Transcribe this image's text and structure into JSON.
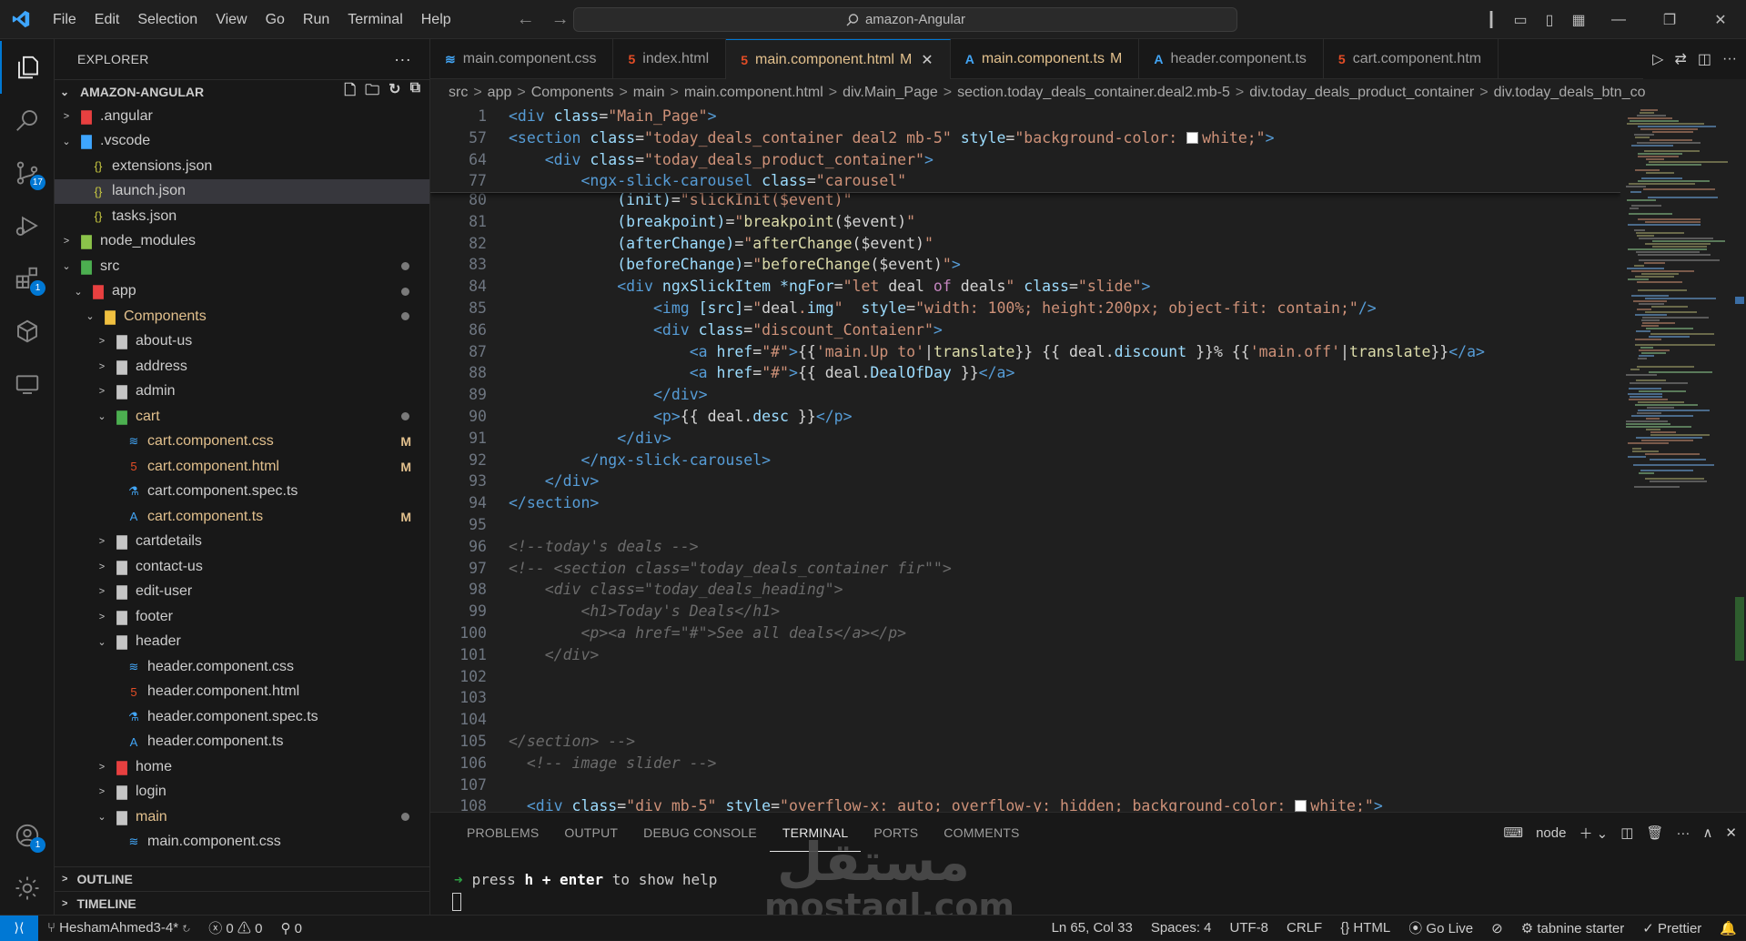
{
  "titlebar": {
    "menus": [
      "File",
      "Edit",
      "Selection",
      "View",
      "Go",
      "Run",
      "Terminal",
      "Help"
    ],
    "search_text": "amazon-Angular"
  },
  "activity": {
    "scm_badge": "17",
    "extensions_badge": "1",
    "accounts_badge": "1"
  },
  "explorer": {
    "title": "EXPLORER",
    "more": "···",
    "project": "AMAZON-ANGULAR",
    "tree": [
      {
        "label": ".angular",
        "depth": 1,
        "chev": ">",
        "icon": "angular-folder-icon",
        "color": "#e84040"
      },
      {
        "label": ".vscode",
        "depth": 1,
        "chev": "v",
        "icon": "vscode-folder-icon",
        "color": "#3ea6ff"
      },
      {
        "label": "extensions.json",
        "depth": 2,
        "icon": "json-icon",
        "color": "#cbcb41"
      },
      {
        "label": "launch.json",
        "depth": 2,
        "icon": "json-icon",
        "color": "#cbcb41",
        "selected": true
      },
      {
        "label": "tasks.json",
        "depth": 2,
        "icon": "json-icon",
        "color": "#cbcb41"
      },
      {
        "label": "node_modules",
        "depth": 1,
        "chev": ">",
        "icon": "node-folder-icon",
        "color": "#8bc34a"
      },
      {
        "label": "src",
        "depth": 1,
        "chev": "v",
        "icon": "src-folder-icon",
        "color": "#4caf50",
        "dot": true
      },
      {
        "label": "app",
        "depth": 2,
        "chev": "v",
        "icon": "app-folder-icon",
        "color": "#e84040",
        "dot": true
      },
      {
        "label": "Components",
        "depth": 3,
        "chev": "v",
        "icon": "components-folder-icon",
        "color": "#f0c040",
        "mod": true,
        "dot": true
      },
      {
        "label": "about-us",
        "depth": 4,
        "chev": ">",
        "icon": "folder-icon",
        "color": "#c5c5c5"
      },
      {
        "label": "address",
        "depth": 4,
        "chev": ">",
        "icon": "folder-icon",
        "color": "#c5c5c5"
      },
      {
        "label": "admin",
        "depth": 4,
        "chev": ">",
        "icon": "admin-folder-icon",
        "color": "#c5c5c5"
      },
      {
        "label": "cart",
        "depth": 4,
        "chev": "v",
        "icon": "cart-folder-icon",
        "color": "#4caf50",
        "mod": true,
        "dot": true
      },
      {
        "label": "cart.component.css",
        "depth": 5,
        "icon": "css-icon",
        "color": "#42a5f5",
        "mod": true,
        "stat": "M"
      },
      {
        "label": "cart.component.html",
        "depth": 5,
        "icon": "html-icon",
        "color": "#e44d26",
        "mod": true,
        "stat": "M"
      },
      {
        "label": "cart.component.spec.ts",
        "depth": 5,
        "icon": "flask-icon",
        "color": "#42a5f5"
      },
      {
        "label": "cart.component.ts",
        "depth": 5,
        "icon": "angular-icon",
        "color": "#42a5f5",
        "mod": true,
        "stat": "M"
      },
      {
        "label": "cartdetails",
        "depth": 4,
        "chev": ">",
        "icon": "folder-icon",
        "color": "#c5c5c5"
      },
      {
        "label": "contact-us",
        "depth": 4,
        "chev": ">",
        "icon": "folder-icon",
        "color": "#c5c5c5"
      },
      {
        "label": "edit-user",
        "depth": 4,
        "chev": ">",
        "icon": "folder-icon",
        "color": "#c5c5c5"
      },
      {
        "label": "footer",
        "depth": 4,
        "chev": ">",
        "icon": "folder-icon",
        "color": "#c5c5c5"
      },
      {
        "label": "header",
        "depth": 4,
        "chev": "v",
        "icon": "folder-icon",
        "color": "#c5c5c5"
      },
      {
        "label": "header.component.css",
        "depth": 5,
        "icon": "css-icon",
        "color": "#42a5f5"
      },
      {
        "label": "header.component.html",
        "depth": 5,
        "icon": "html-icon",
        "color": "#e44d26"
      },
      {
        "label": "header.component.spec.ts",
        "depth": 5,
        "icon": "flask-icon",
        "color": "#42a5f5"
      },
      {
        "label": "header.component.ts",
        "depth": 5,
        "icon": "angular-icon",
        "color": "#42a5f5"
      },
      {
        "label": "home",
        "depth": 4,
        "chev": ">",
        "icon": "home-folder-icon",
        "color": "#e84040"
      },
      {
        "label": "login",
        "depth": 4,
        "chev": ">",
        "icon": "folder-icon",
        "color": "#c5c5c5"
      },
      {
        "label": "main",
        "depth": 4,
        "chev": "v",
        "icon": "folder-icon",
        "color": "#c5c5c5",
        "mod": true,
        "dot": true
      },
      {
        "label": "main.component.css",
        "depth": 5,
        "icon": "css-icon",
        "color": "#42a5f5"
      }
    ],
    "outline": "OUTLINE",
    "timeline": "TIMELINE"
  },
  "tabs": [
    {
      "label": "main.component.css",
      "icon": "css-icon",
      "color": "#42a5f5"
    },
    {
      "label": "index.html",
      "icon": "html-icon",
      "color": "#e44d26"
    },
    {
      "label": "main.component.html",
      "icon": "html-icon",
      "color": "#e44d26",
      "active": true,
      "modified": "M"
    },
    {
      "label": "main.component.ts",
      "icon": "angular-icon",
      "color": "#42a5f5",
      "modified": "M"
    },
    {
      "label": "header.component.ts",
      "icon": "angular-icon",
      "color": "#42a5f5"
    },
    {
      "label": "cart.component.htm",
      "icon": "html-icon",
      "color": "#e44d26"
    }
  ],
  "breadcrumb": [
    "src",
    "app",
    "Components",
    "main",
    "main.component.html",
    "div.Main_Page",
    "section.today_deals_container.deal2.mb-5",
    "div.today_deals_product_container",
    "div.today_deals_btn_co"
  ],
  "editor": {
    "sticky": [
      {
        "n": "1",
        "segs": [
          [
            "t",
            "<div "
          ],
          [
            "a",
            "class"
          ],
          [
            "w",
            "="
          ],
          [
            "s",
            "\"Main_Page\""
          ],
          [
            "t",
            ">"
          ]
        ]
      },
      {
        "n": "57",
        "segs": [
          [
            "t",
            "<section "
          ],
          [
            "a",
            "class"
          ],
          [
            "w",
            "="
          ],
          [
            "s",
            "\"today_deals_container deal2 mb-5\""
          ],
          [
            "w",
            " "
          ],
          [
            "a",
            "style"
          ],
          [
            "w",
            "="
          ],
          [
            "s",
            "\"background-color: "
          ],
          [
            "sw",
            ""
          ],
          [
            "s",
            "white;\""
          ],
          [
            "t",
            ">"
          ]
        ]
      },
      {
        "n": "64",
        "segs": [
          [
            "w",
            "    "
          ],
          [
            "t",
            "<div "
          ],
          [
            "a",
            "class"
          ],
          [
            "w",
            "="
          ],
          [
            "s",
            "\"today_deals_product_container\""
          ],
          [
            "t",
            ">"
          ]
        ]
      },
      {
        "n": "77",
        "segs": [
          [
            "w",
            "        "
          ],
          [
            "t",
            "<ngx-slick-carousel "
          ],
          [
            "a",
            "class"
          ],
          [
            "w",
            "="
          ],
          [
            "s",
            "\"carousel\""
          ]
        ]
      }
    ],
    "lines": [
      {
        "n": "80",
        "segs": [
          [
            "w",
            "            "
          ],
          [
            "a",
            "(init)"
          ],
          [
            "w",
            "="
          ],
          [
            "s",
            "\"slickInit($event)\""
          ]
        ]
      },
      {
        "n": "81",
        "segs": [
          [
            "w",
            "            "
          ],
          [
            "a",
            "(breakpoint)"
          ],
          [
            "w",
            "="
          ],
          [
            "s",
            "\""
          ],
          [
            "f",
            "breakpoint"
          ],
          [
            "w",
            "($event)"
          ],
          [
            "s",
            "\""
          ]
        ]
      },
      {
        "n": "82",
        "segs": [
          [
            "w",
            "            "
          ],
          [
            "a",
            "(afterChange)"
          ],
          [
            "w",
            "="
          ],
          [
            "s",
            "\""
          ],
          [
            "f",
            "afterChange"
          ],
          [
            "w",
            "($event)"
          ],
          [
            "s",
            "\""
          ]
        ]
      },
      {
        "n": "83",
        "segs": [
          [
            "w",
            "            "
          ],
          [
            "a",
            "(beforeChange)"
          ],
          [
            "w",
            "="
          ],
          [
            "s",
            "\""
          ],
          [
            "f",
            "beforeChange"
          ],
          [
            "w",
            "($event)"
          ],
          [
            "s",
            "\""
          ],
          [
            "t",
            ">"
          ]
        ]
      },
      {
        "n": "84",
        "segs": [
          [
            "w",
            "            "
          ],
          [
            "t",
            "<div "
          ],
          [
            "a",
            "ngxSlickItem *ngFor"
          ],
          [
            "w",
            "="
          ],
          [
            "s",
            "\"let "
          ],
          [
            "w",
            "deal "
          ],
          [
            "k",
            "of "
          ],
          [
            "w",
            "deals"
          ],
          [
            "s",
            "\""
          ],
          [
            "w",
            " "
          ],
          [
            "a",
            "class"
          ],
          [
            "w",
            "="
          ],
          [
            "s",
            "\"slide\""
          ],
          [
            "t",
            ">"
          ]
        ]
      },
      {
        "n": "85",
        "segs": [
          [
            "w",
            "                "
          ],
          [
            "t",
            "<img "
          ],
          [
            "a",
            "[src]"
          ],
          [
            "w",
            "="
          ],
          [
            "s",
            "\""
          ],
          [
            "w",
            "deal"
          ],
          [
            "s",
            "."
          ],
          [
            "v",
            "img"
          ],
          [
            "s",
            "\""
          ],
          [
            "w",
            "  "
          ],
          [
            "a",
            "style"
          ],
          [
            "w",
            "="
          ],
          [
            "s",
            "\"width: 100%; height:200px; object-fit: contain;\""
          ],
          [
            "t",
            "/>"
          ]
        ]
      },
      {
        "n": "86",
        "segs": [
          [
            "w",
            "                "
          ],
          [
            "t",
            "<div "
          ],
          [
            "a",
            "class"
          ],
          [
            "w",
            "="
          ],
          [
            "s",
            "\"discount_Contaienr\""
          ],
          [
            "t",
            ">"
          ]
        ]
      },
      {
        "n": "87",
        "segs": [
          [
            "w",
            "                    "
          ],
          [
            "t",
            "<a "
          ],
          [
            "a",
            "href"
          ],
          [
            "w",
            "="
          ],
          [
            "s",
            "\"#\""
          ],
          [
            "t",
            ">"
          ],
          [
            "w",
            "{{"
          ],
          [
            "s",
            "'main.Up to'"
          ],
          [
            "w",
            "|"
          ],
          [
            "f",
            "translate"
          ],
          [
            "w",
            "}} {{ deal."
          ],
          [
            "v",
            "discount"
          ],
          [
            "w",
            " }}% {{"
          ],
          [
            "s",
            "'main.off'"
          ],
          [
            "w",
            "|"
          ],
          [
            "f",
            "translate"
          ],
          [
            "w",
            "}}"
          ],
          [
            "t",
            "</a>"
          ]
        ]
      },
      {
        "n": "88",
        "segs": [
          [
            "w",
            "                    "
          ],
          [
            "t",
            "<a "
          ],
          [
            "a",
            "href"
          ],
          [
            "w",
            "="
          ],
          [
            "s",
            "\"#\""
          ],
          [
            "t",
            ">"
          ],
          [
            "w",
            "{{ deal."
          ],
          [
            "v",
            "DealOfDay"
          ],
          [
            "w",
            " }}"
          ],
          [
            "t",
            "</a>"
          ]
        ]
      },
      {
        "n": "89",
        "segs": [
          [
            "w",
            "                "
          ],
          [
            "t",
            "</div>"
          ]
        ]
      },
      {
        "n": "90",
        "segs": [
          [
            "w",
            "                "
          ],
          [
            "t",
            "<p>"
          ],
          [
            "w",
            "{{ deal."
          ],
          [
            "v",
            "desc"
          ],
          [
            "w",
            " }}"
          ],
          [
            "t",
            "</p>"
          ]
        ]
      },
      {
        "n": "91",
        "segs": [
          [
            "w",
            "            "
          ],
          [
            "t",
            "</div>"
          ]
        ]
      },
      {
        "n": "92",
        "segs": [
          [
            "w",
            "        "
          ],
          [
            "t",
            "</ngx-slick-carousel>"
          ]
        ]
      },
      {
        "n": "93",
        "segs": [
          [
            "w",
            "    "
          ],
          [
            "t",
            "</div>"
          ]
        ]
      },
      {
        "n": "94",
        "segs": [
          [
            "t",
            "</section>"
          ]
        ]
      },
      {
        "n": "95",
        "segs": []
      },
      {
        "n": "96",
        "segs": [
          [
            "cm",
            "<!--today's deals -->"
          ]
        ]
      },
      {
        "n": "97",
        "segs": [
          [
            "cm",
            "<!-- <section class=\"today_deals_container fir\"\">"
          ]
        ]
      },
      {
        "n": "98",
        "segs": [
          [
            "cm",
            "    <div class=\"today_deals_heading\">"
          ]
        ]
      },
      {
        "n": "99",
        "segs": [
          [
            "cm",
            "        <h1>Today's Deals</h1>"
          ]
        ]
      },
      {
        "n": "100",
        "segs": [
          [
            "cm",
            "        <p><a href=\"#\">See all deals</a></p>"
          ]
        ]
      },
      {
        "n": "101",
        "segs": [
          [
            "cm",
            "    </div>"
          ]
        ]
      },
      {
        "n": "102",
        "segs": []
      },
      {
        "n": "103",
        "segs": []
      },
      {
        "n": "104",
        "segs": []
      },
      {
        "n": "105",
        "segs": [
          [
            "cm",
            "</section> -->"
          ]
        ]
      },
      {
        "n": "106",
        "segs": [
          [
            "cm",
            "  <!-- image slider -->"
          ]
        ]
      },
      {
        "n": "107",
        "segs": []
      },
      {
        "n": "108",
        "segs": [
          [
            "w",
            "  "
          ],
          [
            "t",
            "<div "
          ],
          [
            "a",
            "class"
          ],
          [
            "w",
            "="
          ],
          [
            "s",
            "\"div mb-5\""
          ],
          [
            "w",
            " "
          ],
          [
            "a",
            "style"
          ],
          [
            "w",
            "="
          ],
          [
            "s",
            "\"overflow-x: auto; overflow-y: hidden; background-color: "
          ],
          [
            "sw",
            ""
          ],
          [
            "s",
            "white;\""
          ],
          [
            "t",
            ">"
          ]
        ]
      }
    ]
  },
  "panel": {
    "tabs": [
      "PROBLEMS",
      "OUTPUT",
      "DEBUG CONSOLE",
      "TERMINAL",
      "PORTS",
      "COMMENTS"
    ],
    "active_tab": "TERMINAL",
    "shell": "node",
    "terminal_prefix": "press",
    "terminal_key": "h + enter",
    "terminal_suffix": "to show help"
  },
  "watermark": {
    "arabic": "مستقل",
    "latin": "mostaql.com"
  },
  "status": {
    "branch": "HeshamAhmed3-4*",
    "errors": "0",
    "warnings": "0",
    "ports": "0",
    "position": "Ln 65, Col 33",
    "spaces": "Spaces: 4",
    "encoding": "UTF-8",
    "eol": "CRLF",
    "language": "HTML",
    "golive": "Go Live",
    "tabnine": "tabnine starter",
    "prettier": "Prettier"
  }
}
